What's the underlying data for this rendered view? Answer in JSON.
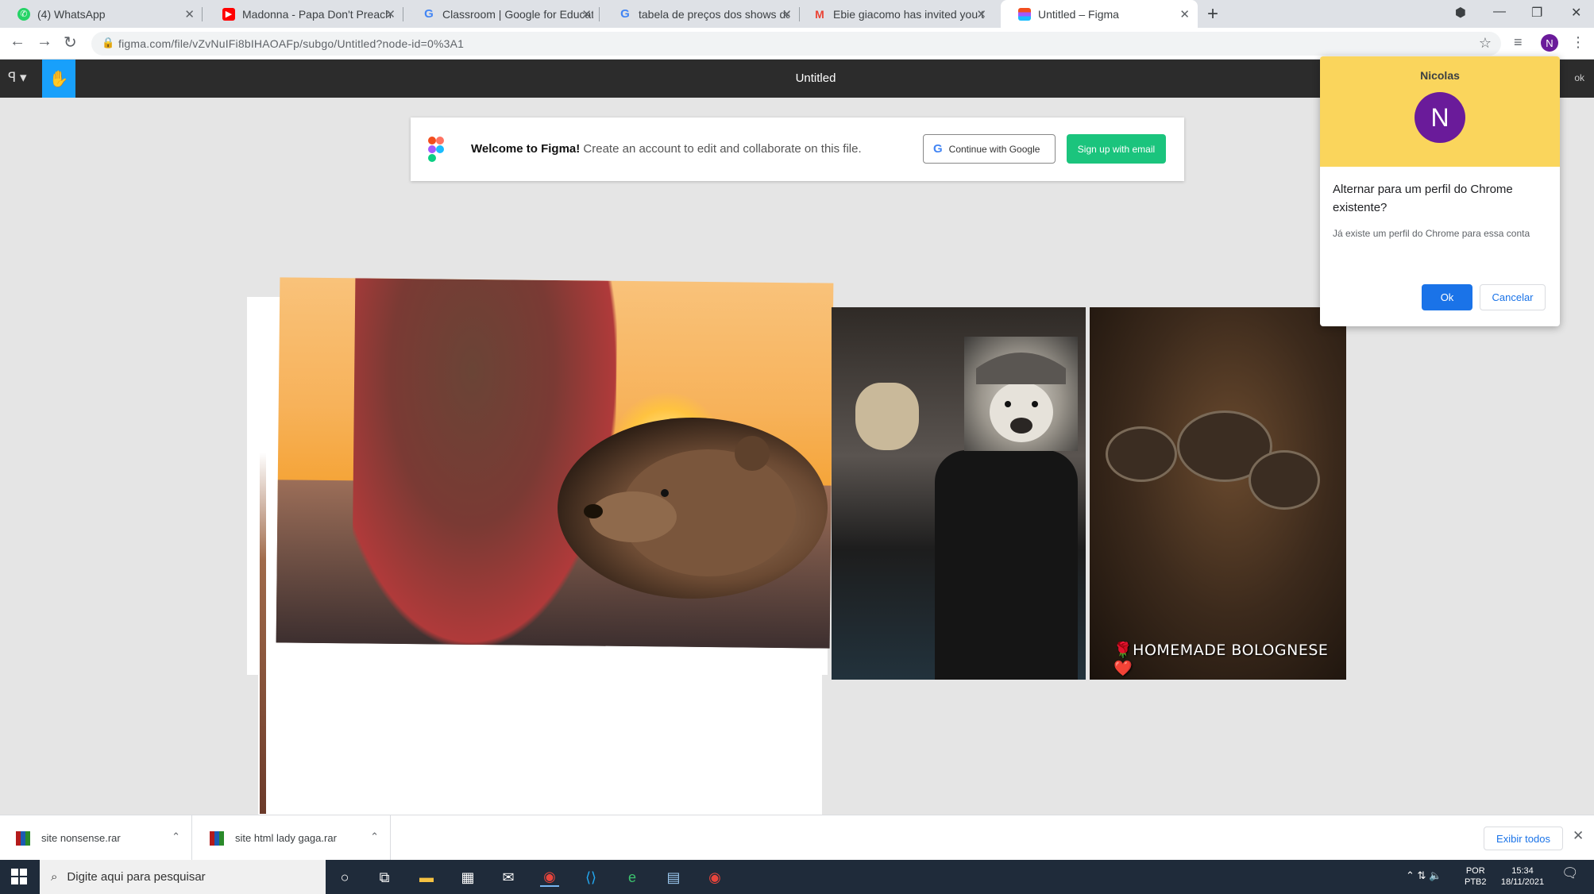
{
  "browser": {
    "tabs": [
      {
        "title": "(4) WhatsApp",
        "favicon": "whatsapp-icon",
        "color": "#25d366",
        "glyph": "✆"
      },
      {
        "title": "Madonna - Papa Don't Preach (C",
        "favicon": "youtube-icon",
        "color": "#ff0000",
        "glyph": "▶"
      },
      {
        "title": "Classroom | Google for Educatio",
        "favicon": "google-icon",
        "color": "#4285f4",
        "glyph": "G"
      },
      {
        "title": "tabela de preços dos shows da",
        "favicon": "google-icon",
        "color": "#4285f4",
        "glyph": "G"
      },
      {
        "title": "Ebie giacomo has invited you to",
        "favicon": "gmail-icon",
        "color": "#ea4335",
        "glyph": "M"
      },
      {
        "title": "Untitled – Figma",
        "favicon": "figma-icon",
        "color": "#f24e1e",
        "glyph": "F"
      }
    ],
    "url": "figma.com/file/vZvNuIFi8bIHAOAFp/subgo/Untitled?node-id=0%3A1"
  },
  "figma": {
    "title": "Untitled",
    "zoom": "ok",
    "banner": {
      "welcome_bold": "Welcome to Figma!",
      "welcome_text": " Create an account to edit and collaborate on this file.",
      "google_button": "Continue with Google",
      "email_button": "Sign up with email"
    },
    "food_caption": "🌹HOMEMADE BOLOGNESE❤️"
  },
  "profile_popup": {
    "name": "Nicolas",
    "initial": "N",
    "question": "Alternar para um perfil do Chrome existente?",
    "description": "Já existe um perfil do Chrome para essa conta",
    "ok_label": "Ok",
    "cancel_label": "Cancelar"
  },
  "downloads": {
    "items": [
      {
        "name": "site nonsense.rar"
      },
      {
        "name": "site html lady gaga.rar"
      }
    ],
    "show_all": "Exibir todos"
  },
  "taskbar": {
    "search_placeholder": "Digite aqui para pesquisar",
    "lang_top": "POR",
    "lang_bottom": "PTB2",
    "time": "15:34",
    "date": "18/11/2021"
  }
}
